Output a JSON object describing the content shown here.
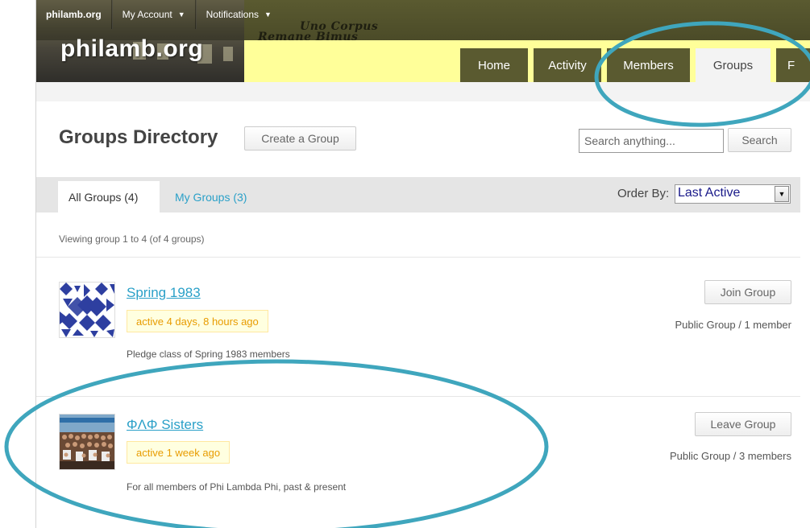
{
  "admin_bar": {
    "brand": "philamb.org",
    "my_account": "My Account",
    "notifications": "Notifications"
  },
  "header": {
    "site_title": "philamb.org",
    "banner_line1": "Uno Corpus",
    "banner_line2": "Remane Bimus"
  },
  "nav": {
    "tabs": [
      {
        "label": "Home"
      },
      {
        "label": "Activity"
      },
      {
        "label": "Members"
      },
      {
        "label": "Groups"
      },
      {
        "label": "F"
      }
    ]
  },
  "directory": {
    "title": "Groups Directory",
    "create_label": "Create a Group",
    "search_placeholder": "Search anything...",
    "search_label": "Search"
  },
  "filter": {
    "tabs": [
      {
        "label": "All Groups (4)"
      },
      {
        "label": "My Groups (3)"
      }
    ],
    "order_label": "Order By:",
    "order_value": "Last Active",
    "viewing_text": "Viewing group 1 to 4 (of 4 groups)"
  },
  "groups": [
    {
      "name": "Spring 1983",
      "activity": "active 4 days, 8 hours ago",
      "description": "Pledge class of Spring 1983 members",
      "action": "Join Group",
      "meta": "Public Group / 1 member"
    },
    {
      "name": "ΦΛΦ Sisters",
      "activity": "active 1 week ago",
      "description": "For all members of Phi Lambda Phi, past & present",
      "action": "Leave Group",
      "meta": "Public Group / 3 members"
    }
  ],
  "colors": {
    "nav_tab": "#5a5a30",
    "link": "#2aa0c8",
    "badge_text": "#e89c00",
    "header_yellow": "#ffff99",
    "annotation": "#3fa6bd"
  },
  "icons": {
    "dropdown": "caret-down-icon",
    "select_arrow": "select-arrow-icon"
  }
}
